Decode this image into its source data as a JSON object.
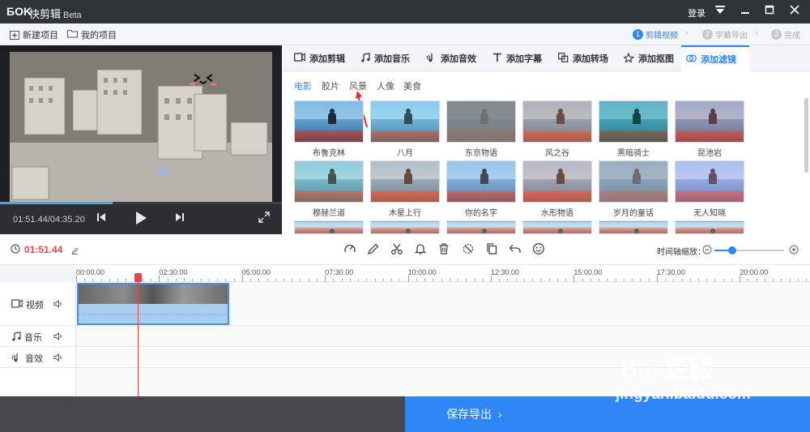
{
  "app": {
    "logo": "ƂOK",
    "title": "快剪辑",
    "beta": "Beta",
    "login": "登录"
  },
  "toolbar": {
    "new_project": "新建项目",
    "my_projects": "我的项目",
    "steps": [
      {
        "num": "1",
        "label": "剪辑视频",
        "active": true
      },
      {
        "num": "2",
        "label": "字幕导出",
        "active": false
      },
      {
        "num": "3",
        "label": "完成",
        "active": false
      }
    ]
  },
  "player": {
    "time": "01:51.44/04:35.20",
    "progress": 0.4
  },
  "tabs": [
    {
      "label": "添加剪辑",
      "icon": "video-icon"
    },
    {
      "label": "添加音乐",
      "icon": "music-icon"
    },
    {
      "label": "添加音效",
      "icon": "sound-effect-icon"
    },
    {
      "label": "添加字幕",
      "icon": "text-icon"
    },
    {
      "label": "添加转场",
      "icon": "transition-icon"
    },
    {
      "label": "添加抠图",
      "icon": "cutout-icon"
    },
    {
      "label": "添加滤镜",
      "icon": "filter-icon",
      "active": true
    }
  ],
  "categories": [
    {
      "label": "电影",
      "active": true
    },
    {
      "label": "胶片",
      "active": false
    },
    {
      "label": "风景",
      "active": false
    },
    {
      "label": "人像",
      "active": false
    },
    {
      "label": "美食",
      "active": false
    }
  ],
  "filters": [
    {
      "label": "布鲁克林",
      "tint": "rgba(40,120,220,0.15)"
    },
    {
      "label": "八月",
      "tint": "rgba(120,220,255,0.25)"
    },
    {
      "label": "东京物语",
      "tint": "rgba(128,128,128,0.85)"
    },
    {
      "label": "风之谷",
      "tint": "rgba(220,150,130,0.4)"
    },
    {
      "label": "黑暗骑士",
      "tint": "rgba(0,150,140,0.35)"
    },
    {
      "label": "昆池岩",
      "tint": "rgba(200,120,140,0.35)"
    },
    {
      "label": "穆赫兰道",
      "tint": "rgba(150,220,200,0.3)"
    },
    {
      "label": "木星上行",
      "tint": "rgba(255,180,140,0.3)"
    },
    {
      "label": "你的名字",
      "tint": "rgba(180,200,255,0.25)"
    },
    {
      "label": "水形物语",
      "tint": "rgba(255,160,140,0.35)"
    },
    {
      "label": "岁月的童话",
      "tint": "rgba(160,160,170,0.6)"
    },
    {
      "label": "无人知晓",
      "tint": "rgba(220,180,255,0.35)"
    }
  ],
  "timeline": {
    "current_time": "01:51.44",
    "zoom_label": "时间轴缩放：",
    "zoom_level": 0.25,
    "ruler_labels": [
      "00:00.00",
      "02:30.00",
      "05:00.00",
      "07:30.00",
      "10:00.00",
      "12:30.00",
      "15:00.00",
      "17:30.00",
      "20:00.00"
    ],
    "tracks": [
      {
        "label": "视频",
        "icon": "video-track-icon"
      },
      {
        "label": "音乐",
        "icon": "music-track-icon"
      },
      {
        "label": "音效",
        "icon": "sound-track-icon"
      }
    ]
  },
  "footer": {
    "save_export": "保存导出"
  },
  "watermark": {
    "brand": "Bai 经验",
    "url": "jingyan.baidu.com"
  },
  "colors": {
    "accent": "#2f86f6",
    "titlebar": "#2f3439",
    "playhead": "#e04848",
    "footer": "#46494e"
  }
}
